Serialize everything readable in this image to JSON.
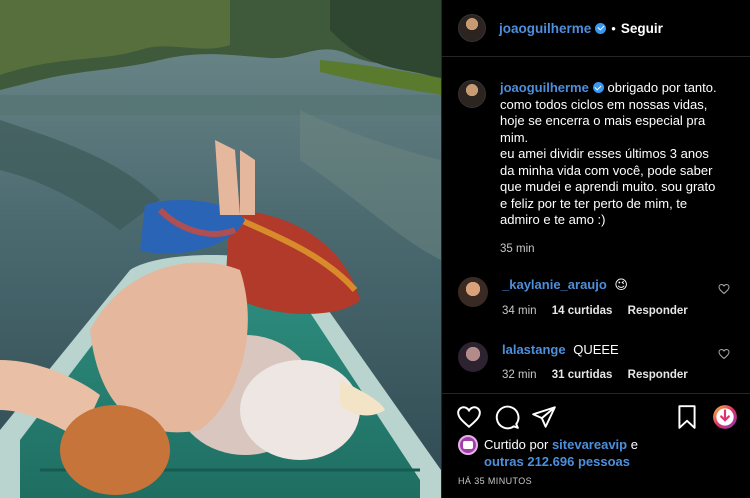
{
  "post": {
    "username": "joaoguilherme",
    "follow_label": "Seguir",
    "separator": "•"
  },
  "caption": {
    "username": "joaoguilherme",
    "text": "obrigado por tanto.\ncomo todos ciclos em nossas vidas,\nhoje se encerra o mais especial pra\nmim.\neu amei dividir esses últimos 3 anos\nda minha vida com você, pode saber\nque mudei e aprendi muito. sou grato\ne feliz por te ter perto de mim, te\nadmiro e te amo :)",
    "time": "35 min"
  },
  "comments": [
    {
      "username": "_kaylanie_araujo",
      "text": "😉",
      "time": "34 min",
      "likes": "14 curtidas",
      "reply": "Responder",
      "avatar_color": "#7a4b3c"
    },
    {
      "username": "lalastange",
      "text": "QUEEE",
      "time": "32 min",
      "likes": "31 curtidas",
      "reply": "Responder",
      "avatar_color": "#5a4a66"
    }
  ],
  "actions": {
    "icons": [
      "heart-icon",
      "comment-icon",
      "share-icon",
      "bookmark-icon"
    ],
    "liked_prefix": "Curtido por",
    "liked_account": "sitevareavip",
    "liked_connector": "e",
    "liked_others": "outras 212.696 pessoas",
    "timestamp": "HÁ 35 MINUTOS"
  },
  "colors": {
    "link": "#4d8fdc",
    "verified": "#3897f0",
    "divider": "#262626"
  }
}
